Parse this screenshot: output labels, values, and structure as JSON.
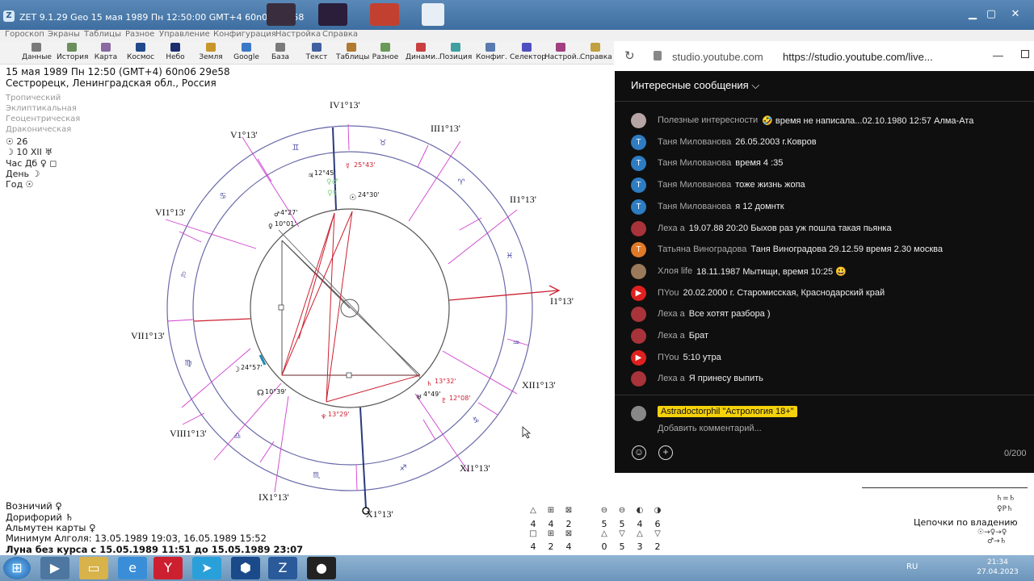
{
  "window": {
    "title": "ZET 9.1.29 Geo   15 мая 1989  Пн  12:50:00 GMT+4 60n06  29e58"
  },
  "menu": [
    "Гороскоп",
    "Экраны",
    "Таблицы",
    "Разное",
    "Управление",
    "Конфигурация",
    "Настройка",
    "Справка"
  ],
  "toolbar": [
    {
      "label": "Данные",
      "color": "#7a7a7a"
    },
    {
      "label": "История",
      "color": "#6b8e5a"
    },
    {
      "label": "Карта",
      "color": "#8a6aa0"
    },
    {
      "label": "Космос",
      "color": "#204a8a"
    },
    {
      "label": "Небо",
      "color": "#1b2f6e"
    },
    {
      "label": "Земля",
      "color": "#c8962a"
    },
    {
      "label": "Google",
      "color": "#3c78c8"
    },
    {
      "label": "База",
      "color": "#7a7a7a"
    },
    {
      "label": "Текст",
      "color": "#4060a0"
    },
    {
      "label": "Таблицы",
      "color": "#b07a30"
    },
    {
      "label": "Разное",
      "color": "#6a9a5a"
    },
    {
      "label": "Динами..",
      "color": "#c84040"
    },
    {
      "label": "Позиция",
      "color": "#40a0a0"
    },
    {
      "label": "Конфиг.",
      "color": "#5a7ab0"
    },
    {
      "label": "Селектор",
      "color": "#5050c0"
    },
    {
      "label": "Настрой..",
      "color": "#a04080"
    },
    {
      "label": "Справка",
      "color": "#c0a040"
    }
  ],
  "chart_info": {
    "date_line": "15 мая 1989  Пн  12:50 (GMT+4) 60n06  29e58",
    "place_line": "Сестрорецк, Ленинградская обл., Россия",
    "modes": [
      "Тропический",
      "Эклиптикальная",
      "Геоцентрическая",
      "Драконическая"
    ],
    "stats": [
      "☉ 26",
      "☽ 10 XII ♅",
      "Час Дб ♀ ◻",
      "День ☽",
      "Год ☉"
    ]
  },
  "houses": {
    "I": "I1°13'",
    "II": "II1°13'",
    "III": "III1°13'",
    "IV": "IV1°13'",
    "V": "V1°13'",
    "VI": "VI1°13'",
    "VII": "VII1°13'",
    "VIII": "VIII1°13'",
    "IX": "IX1°13'",
    "X": "X1°13'",
    "XI": "XI1°13'",
    "XII": "XII1°13'"
  },
  "planets": {
    "sun": "24°30'",
    "mars": "4°27'",
    "venus_like": "10°01'",
    "jupiter": "12°45'",
    "mercury": "25°43'",
    "moon": "24°57'",
    "node": "10°39'",
    "neptune": "13°29'",
    "saturn": "13°32'",
    "uranus": "4°49'",
    "pluto_like": "12°08'"
  },
  "bottom_info": {
    "line1": "Возничий ♀",
    "line2": "Дорифорий ♄",
    "line3": "Альмутен карты ♀",
    "line4": "Минимум Алголя: 13.05.1989 19:03,  16.05.1989 15:52",
    "line5": "Луна без курса с 15.05.1989 11:51 до 15.05.1989 23:07"
  },
  "counts": {
    "row1": [
      "4",
      "4",
      "2",
      "5",
      "5",
      "4",
      "6"
    ],
    "row2": [
      "4",
      "2",
      "4",
      "0",
      "5",
      "3",
      "2"
    ]
  },
  "chains_label": "Цепочки по владению",
  "youtube": {
    "domain": "studio.youtube.com",
    "url": "https://studio.youtube.com/live...",
    "header": "Интересные сообщения",
    "messages": [
      {
        "author": "Полезные интересности",
        "text": "🤣 время не написала...02.10.1980 12:57 Алма-Ата",
        "avatar": "",
        "avcolor": "#b7a4a4"
      },
      {
        "author": "Таня Милованова",
        "text": "26.05.2003 г.Ковров",
        "avatar": "Т",
        "avcolor": "#2e7cc2"
      },
      {
        "author": "Таня Милованова",
        "text": "время 4 :35",
        "avatar": "Т",
        "avcolor": "#2e7cc2"
      },
      {
        "author": "Таня Милованова",
        "text": "тоже жизнь жопа",
        "avatar": "Т",
        "avcolor": "#2e7cc2"
      },
      {
        "author": "Таня Милованова",
        "text": "я 12 домнтк",
        "avatar": "Т",
        "avcolor": "#2e7cc2"
      },
      {
        "author": "Леха а",
        "text": "19.07.88 20:20 Быхов раз уж пошла такая пьянка",
        "avatar": "",
        "avcolor": "#a8333a"
      },
      {
        "author": "Татьяна Виноградова",
        "text": "Таня Виноградова 29.12.59 время 2.30 москва",
        "avatar": "Т",
        "avcolor": "#e07a26"
      },
      {
        "author": "Хлоя life",
        "text": "18.11.1987 Мытищи, время 10:25 😃",
        "avatar": "",
        "avcolor": "#9a7a5a"
      },
      {
        "author": "ПYou",
        "text": "20.02.2000 г. Старомисская, Краснодарский край",
        "avatar": "▶",
        "avcolor": "#e02020"
      },
      {
        "author": "Леха а",
        "text": "Все хотят разбора )",
        "avatar": "",
        "avcolor": "#a8333a"
      },
      {
        "author": "Леха а",
        "text": "Брат",
        "avatar": "",
        "avcolor": "#a8333a"
      },
      {
        "author": "ПYou",
        "text": "5:10 утра",
        "avatar": "▶",
        "avcolor": "#e02020"
      },
      {
        "author": "Леха а",
        "text": "Я принесу выпить",
        "avatar": "",
        "avcolor": "#a8333a"
      }
    ],
    "sender": "Astradoctorphil \"Астрология 18+\"",
    "add_comment": "Добавить комментарий...",
    "char_count": "0/200"
  },
  "taskbar": {
    "lang": "RU",
    "time": "21:34",
    "date": "27.04.2023"
  }
}
